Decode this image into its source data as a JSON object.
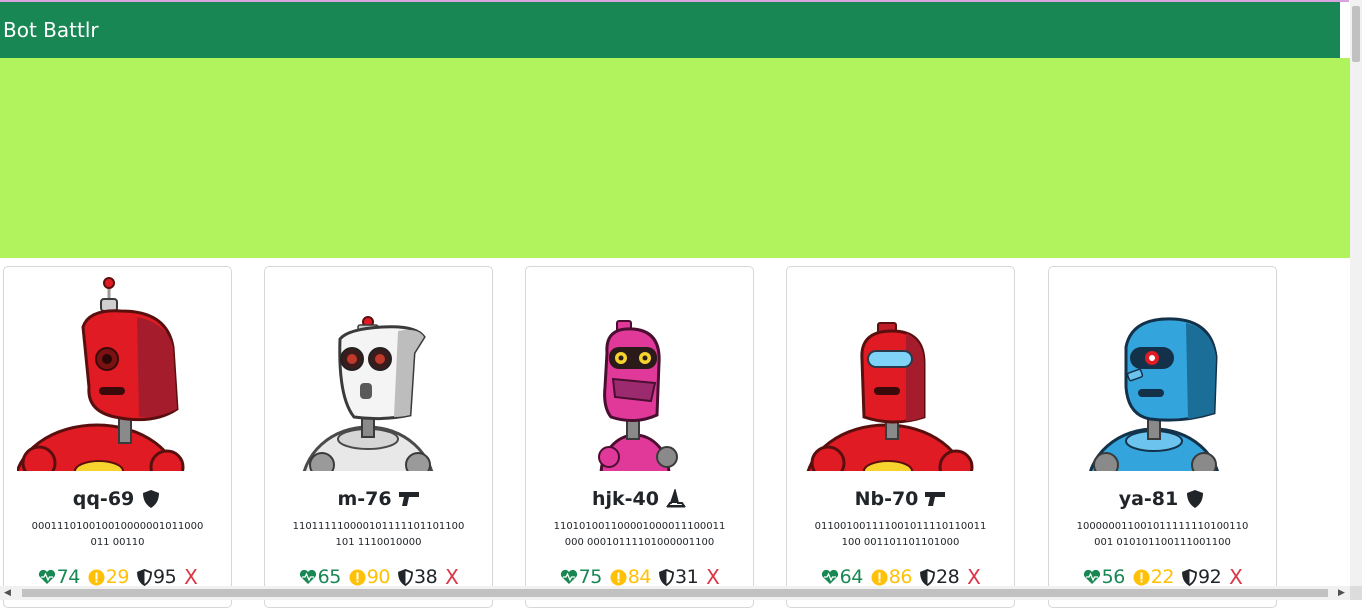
{
  "app": {
    "brand": "Bot Battlr"
  },
  "theme": {
    "navbar": "#198754",
    "banner": "#b0f35d",
    "health": "#198754",
    "damage": "#ffc107",
    "armor": "#212529",
    "delete": "#dc3545"
  },
  "bots": [
    {
      "name": "qq-69",
      "bot_class": "shield-icon",
      "catchphrase": "000111010010010000001011000011 00110",
      "health": "74",
      "damage": "29",
      "armor": "95",
      "delete": "X",
      "color": "red"
    },
    {
      "name": "m-76",
      "bot_class": "pistol-icon",
      "catchphrase": "110111110000101111101101100101 1110010000",
      "health": "65",
      "damage": "90",
      "armor": "38",
      "delete": "X",
      "color": "white"
    },
    {
      "name": "hjk-40",
      "bot_class": "wizard-hat-icon",
      "catchphrase": "110101001100001000011100011000 00010111101000001100",
      "health": "75",
      "damage": "84",
      "armor": "31",
      "delete": "X",
      "color": "pink"
    },
    {
      "name": "Nb-70",
      "bot_class": "pistol-icon",
      "catchphrase": "011001001111001011110110011100 001101101101000",
      "health": "64",
      "damage": "86",
      "armor": "28",
      "delete": "X",
      "color": "red"
    },
    {
      "name": "ya-81",
      "bot_class": "shield-icon",
      "catchphrase": "100000011001011111110100110001 010101100111001100",
      "health": "56",
      "damage": "22",
      "armor": "92",
      "delete": "X",
      "color": "blue"
    }
  ]
}
